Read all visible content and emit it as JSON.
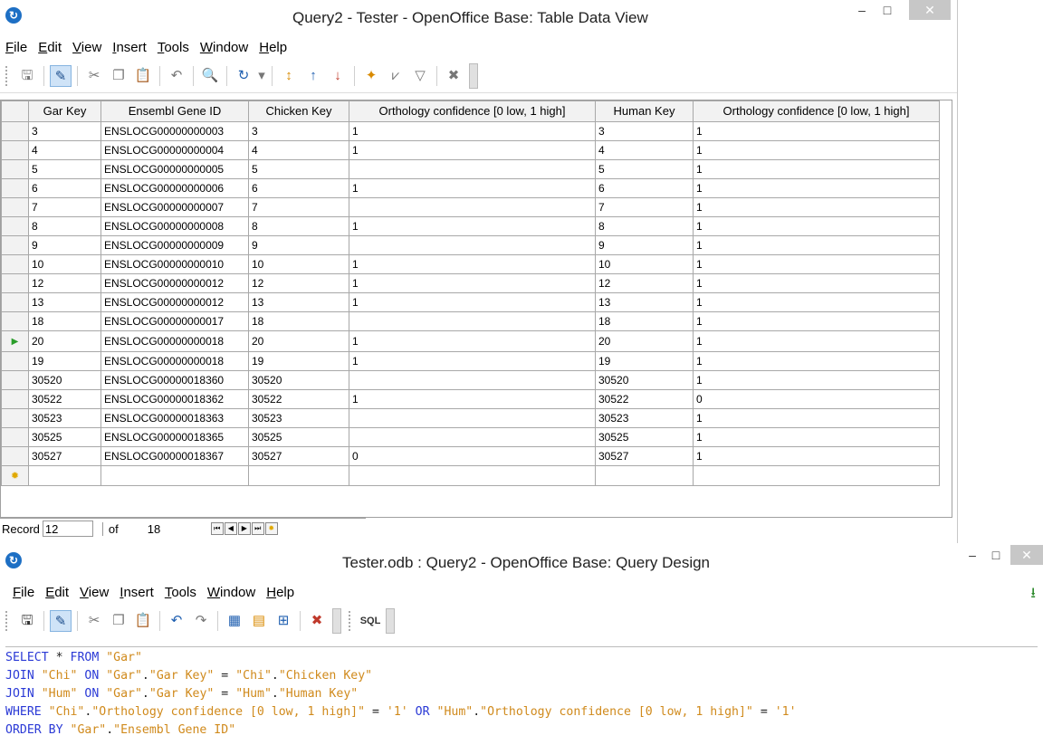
{
  "window1": {
    "title": "Query2 - Tester - OpenOffice Base: Table Data View",
    "menu": [
      "File",
      "Edit",
      "View",
      "Insert",
      "Tools",
      "Window",
      "Help"
    ],
    "columns": [
      "Gar Key",
      "Ensembl Gene ID",
      "Chicken Key",
      "Orthology confidence [0 low, 1 high]",
      "Human Key",
      "Orthology confidence [0 low, 1 high]"
    ],
    "rows": [
      [
        "3",
        "ENSLOCG00000000003",
        "3",
        "1",
        "3",
        "1"
      ],
      [
        "4",
        "ENSLOCG00000000004",
        "4",
        "1",
        "4",
        "1"
      ],
      [
        "5",
        "ENSLOCG00000000005",
        "5",
        "",
        "5",
        "1"
      ],
      [
        "6",
        "ENSLOCG00000000006",
        "6",
        "1",
        "6",
        "1"
      ],
      [
        "7",
        "ENSLOCG00000000007",
        "7",
        "",
        "7",
        "1"
      ],
      [
        "8",
        "ENSLOCG00000000008",
        "8",
        "1",
        "8",
        "1"
      ],
      [
        "9",
        "ENSLOCG00000000009",
        "9",
        "",
        "9",
        "1"
      ],
      [
        "10",
        "ENSLOCG00000000010",
        "10",
        "1",
        "10",
        "1"
      ],
      [
        "12",
        "ENSLOCG00000000012",
        "12",
        "1",
        "12",
        "1"
      ],
      [
        "13",
        "ENSLOCG00000000012",
        "13",
        "1",
        "13",
        "1"
      ],
      [
        "18",
        "ENSLOCG00000000017",
        "18",
        "",
        "18",
        "1"
      ],
      [
        "20",
        "ENSLOCG00000000018",
        "20",
        "1",
        "20",
        "1"
      ],
      [
        "19",
        "ENSLOCG00000000018",
        "19",
        "1",
        "19",
        "1"
      ],
      [
        "30520",
        "ENSLOCG00000018360",
        "30520",
        "",
        "30520",
        "1"
      ],
      [
        "30522",
        "ENSLOCG00000018362",
        "30522",
        "1",
        "30522",
        "0"
      ],
      [
        "30523",
        "ENSLOCG00000018363",
        "30523",
        "",
        "30523",
        "1"
      ],
      [
        "30525",
        "ENSLOCG00000018365",
        "30525",
        "",
        "30525",
        "1"
      ],
      [
        "30527",
        "ENSLOCG00000018367",
        "30527",
        "0",
        "30527",
        "1"
      ]
    ],
    "current_row_index": 11,
    "nav": {
      "record_label": "Record",
      "record_value": "12",
      "of_label": "of",
      "total": "18"
    }
  },
  "window2": {
    "title": "Tester.odb : Query2 - OpenOffice Base: Query Design",
    "menu": [
      "File",
      "Edit",
      "View",
      "Insert",
      "Tools",
      "Window",
      "Help"
    ],
    "sql_lines": [
      "SELECT * FROM \"Gar\"",
      "JOIN \"Chi\" ON \"Gar\".\"Gar Key\" = \"Chi\".\"Chicken Key\"",
      "JOIN \"Hum\" ON \"Gar\".\"Gar Key\" = \"Hum\".\"Human Key\"",
      "WHERE \"Chi\".\"Orthology confidence [0 low, 1 high]\" = '1' OR \"Hum\".\"Orthology confidence [0 low, 1 high]\" = '1'",
      "ORDER BY \"Gar\".\"Ensembl Gene ID\""
    ]
  },
  "colors": {
    "keyword": "#2b3ad6",
    "string": "#d08a1c",
    "selected_tool": "#cfe3f7"
  }
}
